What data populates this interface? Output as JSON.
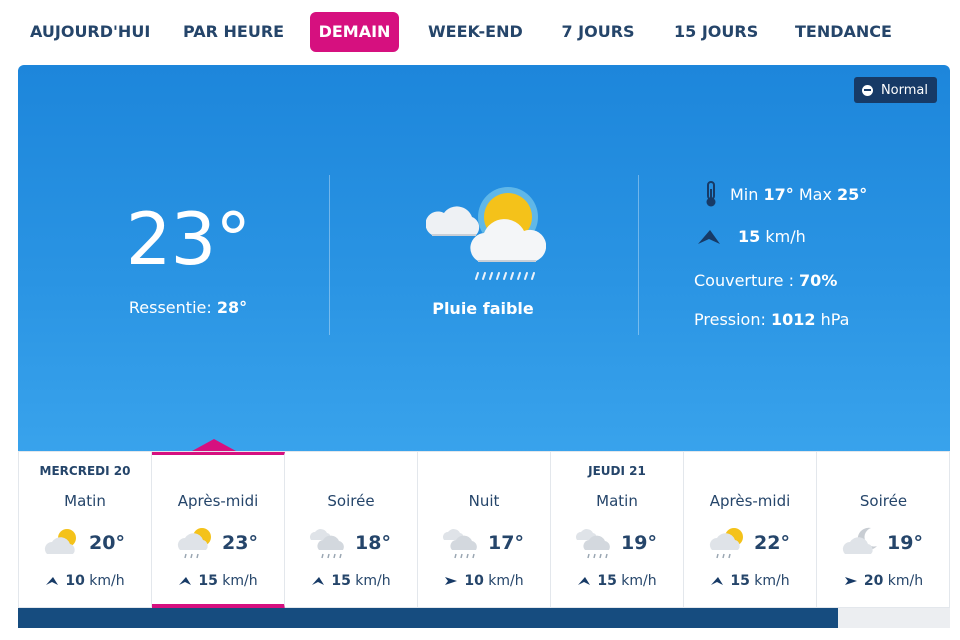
{
  "tabs": [
    {
      "label": "AUJOURD'HUI",
      "active": false
    },
    {
      "label": "PAR HEURE",
      "active": false
    },
    {
      "label": "DEMAIN",
      "active": true
    },
    {
      "label": "WEEK-END",
      "active": false
    },
    {
      "label": "7 JOURS",
      "active": false
    },
    {
      "label": "15 JOURS",
      "active": false
    },
    {
      "label": "TENDANCE",
      "active": false
    }
  ],
  "mode_toggle": {
    "label": "Normal"
  },
  "current": {
    "temperature": "23°",
    "feels_like_label": "Ressentie:",
    "feels_like_value": "28°",
    "condition": "Pluie faible",
    "condition_icon": "rain-cloud-sun-icon"
  },
  "details": {
    "min_label": "Min",
    "min_value": "17°",
    "max_label": "Max",
    "max_value": "25°",
    "wind_value": "15",
    "wind_unit": "km/h",
    "coverage_label": "Couverture :",
    "coverage_value": "70%",
    "pressure_label": "Pression:",
    "pressure_value": "1012",
    "pressure_unit": "hPa"
  },
  "timeline": [
    {
      "day": "MERCREDI 20",
      "period": "Matin",
      "icon": "cloud-sun-icon",
      "temp": "20°",
      "wind": "10",
      "unit": "km/h",
      "active": false
    },
    {
      "day": "",
      "period": "Après-midi",
      "icon": "cloud-sun-rain-icon",
      "temp": "23°",
      "wind": "15",
      "unit": "km/h",
      "active": true
    },
    {
      "day": "",
      "period": "Soirée",
      "icon": "cloud-rain-icon",
      "temp": "18°",
      "wind": "15",
      "unit": "km/h",
      "active": false
    },
    {
      "day": "",
      "period": "Nuit",
      "icon": "cloud-rain-icon",
      "temp": "17°",
      "wind": "10",
      "unit": "km/h",
      "active": false
    },
    {
      "day": "JEUDI 21",
      "period": "Matin",
      "icon": "cloud-rain-icon",
      "temp": "19°",
      "wind": "15",
      "unit": "km/h",
      "active": false
    },
    {
      "day": "",
      "period": "Après-midi",
      "icon": "cloud-sun-rain-icon",
      "temp": "22°",
      "wind": "15",
      "unit": "km/h",
      "active": false
    },
    {
      "day": "",
      "period": "Soirée",
      "icon": "cloud-moon-icon",
      "temp": "19°",
      "wind": "20",
      "unit": "km/h",
      "active": false
    }
  ],
  "colors": {
    "accent": "#d6107f",
    "navy": "#25456a",
    "panel_top": "#1d86db",
    "panel_bottom": "#39a3ec",
    "scroll_thumb": "#164c7f"
  }
}
